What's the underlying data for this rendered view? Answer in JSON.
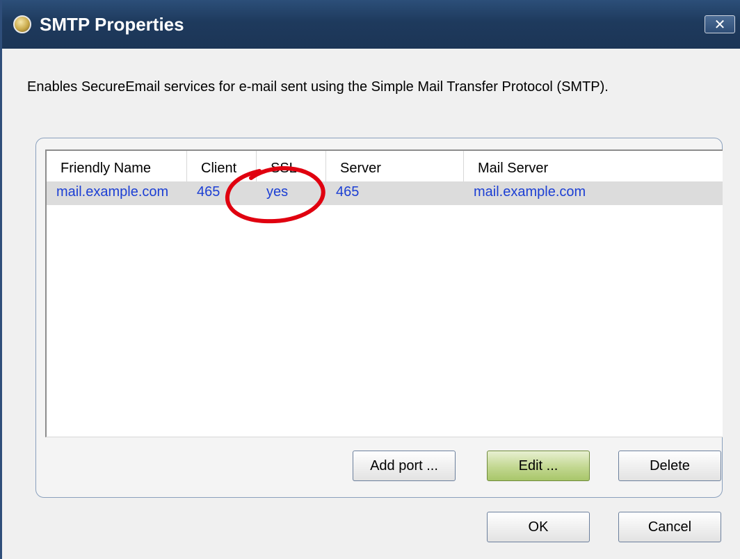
{
  "window": {
    "title": "SMTP Properties",
    "close_glyph": "✕",
    "icon": "app-icon"
  },
  "description": "Enables SecureEmail services for e-mail sent using the Simple Mail Transfer Protocol (SMTP).",
  "table": {
    "columns": [
      "Friendly Name",
      "Client",
      "SSL",
      "Server",
      "Mail Server"
    ],
    "rows": [
      {
        "friendly_name": "mail.example.com",
        "client": "465",
        "ssl": "yes",
        "server": "465",
        "mail_server": "mail.example.com"
      }
    ],
    "selected_row": 0
  },
  "buttons": {
    "add_port": "Add port ...",
    "edit": "Edit ...",
    "delete": "Delete",
    "ok": "OK",
    "cancel": "Cancel"
  },
  "colors": {
    "titlebar": "#1e3a5d",
    "link_text": "#1c3fd4",
    "selected_row": "#dcdcdc",
    "default_button": "#c2d790",
    "annotation": "#e0000f"
  }
}
